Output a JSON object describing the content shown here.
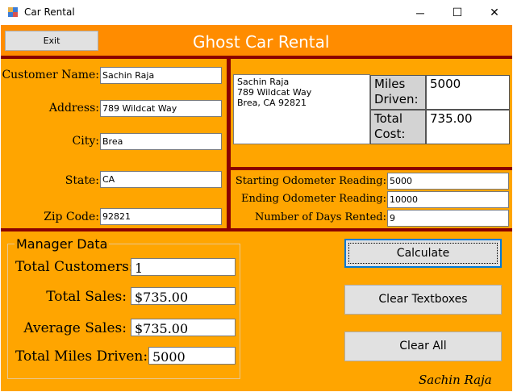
{
  "window": {
    "title": "Car Rental",
    "icon": "winforms-app-icon",
    "controls": {
      "minimize": "─",
      "maximize": "☐",
      "close": "✕"
    }
  },
  "toolbar": {
    "exit_label": "Exit",
    "app_title": "Ghost Car Rental"
  },
  "customer": {
    "name_label": "Customer Name:",
    "name_value": "Sachin Raja",
    "address_label": "Address:",
    "address_value": "789 Wildcat Way",
    "city_label": "City:",
    "city_value": "Brea",
    "state_label": "State:",
    "state_value": "CA",
    "zip_label": "Zip Code:",
    "zip_value": "92821"
  },
  "summary": {
    "address_lines": [
      "Sachin Raja",
      "789 Wildcat Way",
      "Brea, CA  92821"
    ],
    "miles_label": "Miles Driven:",
    "miles_value": "5000",
    "cost_label": "Total Cost:",
    "cost_value": "735.00"
  },
  "odometer": {
    "start_label": "Starting Odometer Reading:",
    "start_value": "5000",
    "end_label": "Ending Odometer Reading:",
    "end_value": "10000",
    "days_label": "Number of Days Rented:",
    "days_value": "9"
  },
  "manager": {
    "title": "Manager Data",
    "customers_label": "Total Customers:",
    "customers_value": "1",
    "sales_label": "Total Sales:",
    "sales_value": "$735.00",
    "avg_label": "Average Sales:",
    "avg_value": "$735.00",
    "miles_label": "Total Miles Driven:",
    "miles_value": "5000"
  },
  "buttons": {
    "calculate_label": "Calculate",
    "clear_textboxes_label": "Clear Textboxes",
    "clear_all_label": "Clear All"
  },
  "signature": "Sachin Raja",
  "colors": {
    "background": "#FFA500",
    "topbar": "#FF8C00",
    "divider": "#8B0000",
    "title_text": "#FFFFFF"
  }
}
